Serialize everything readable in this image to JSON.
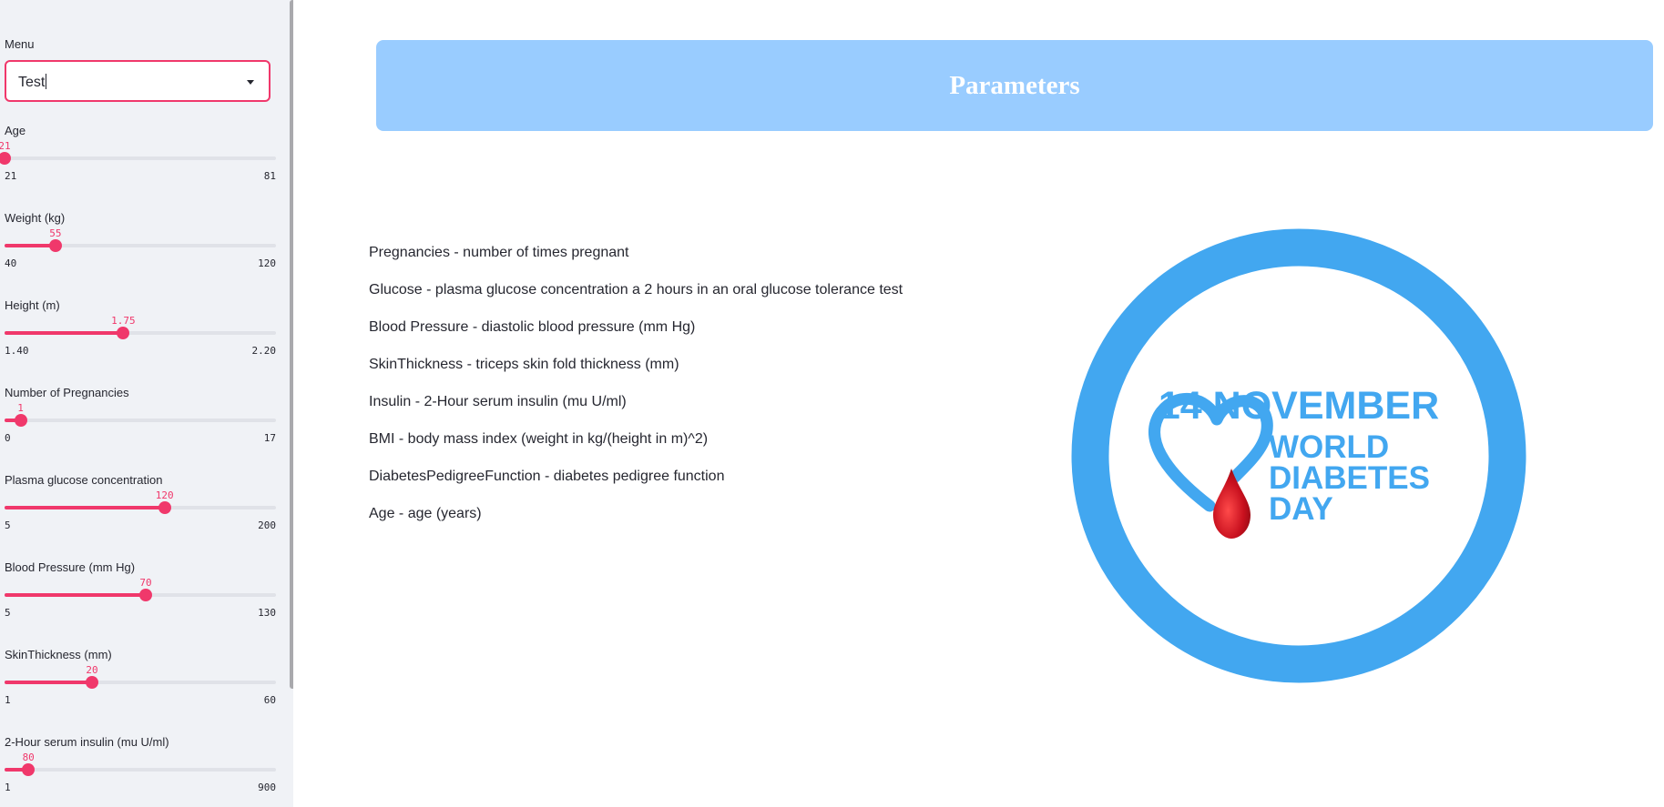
{
  "sidebar": {
    "menu_label": "Menu",
    "menu_value": "Test",
    "sliders": [
      {
        "label": "Age",
        "value": "21",
        "min": "21",
        "max": "81",
        "fraction": 0.0
      },
      {
        "label": "Weight (kg)",
        "value": "55",
        "min": "40",
        "max": "120",
        "fraction": 0.1875
      },
      {
        "label": "Height (m)",
        "value": "1.75",
        "min": "1.40",
        "max": "2.20",
        "fraction": 0.4375
      },
      {
        "label": "Number of Pregnancies",
        "value": "1",
        "min": "0",
        "max": "17",
        "fraction": 0.0588
      },
      {
        "label": "Plasma glucose concentration",
        "value": "120",
        "min": "5",
        "max": "200",
        "fraction": 0.5897
      },
      {
        "label": "Blood Pressure (mm Hg)",
        "value": "70",
        "min": "5",
        "max": "130",
        "fraction": 0.52
      },
      {
        "label": "SkinThickness (mm)",
        "value": "20",
        "min": "1",
        "max": "60",
        "fraction": 0.322
      },
      {
        "label": "2-Hour serum insulin (mu U/ml)",
        "value": "80",
        "min": "1",
        "max": "900",
        "fraction": 0.0879
      }
    ]
  },
  "main": {
    "title": "Parameters",
    "params": [
      "Pregnancies - number of times pregnant",
      "Glucose - plasma glucose concentration a 2 hours in an oral glucose tolerance test",
      "Blood Pressure - diastolic blood pressure (mm Hg)",
      "SkinThickness - triceps skin fold thickness (mm)",
      "Insulin - 2-Hour serum insulin (mu U/ml)",
      "BMI - body mass index (weight in kg/(height in m)^2)",
      "DiabetesPedigreeFunction - diabetes pedigree function",
      "Age - age (years)"
    ],
    "logo": {
      "date": "14 NOVEMBER",
      "line1": "WORLD",
      "line2": "DIABETES",
      "line3": "DAY"
    }
  },
  "colors": {
    "accent": "#f0386b",
    "banner": "#99ccff",
    "logo_blue": "#42a7f0",
    "drop_red": "#c8101e"
  }
}
